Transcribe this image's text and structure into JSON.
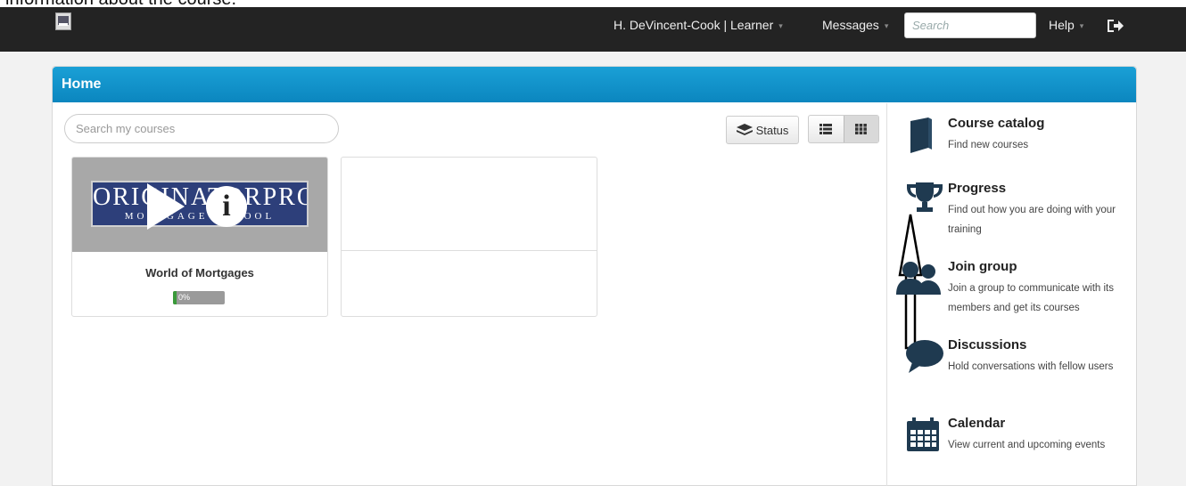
{
  "caption": "information about the course.",
  "topbar": {
    "user": "H. DeVincent-Cook | Learner",
    "messages": "Messages",
    "search_placeholder": "Search",
    "help": "Help",
    "caret": "▾"
  },
  "panel": {
    "title": "Home"
  },
  "courses": {
    "search_placeholder": "Search my courses",
    "status_label": "Status",
    "items": [
      {
        "title": "World of Mortgages",
        "progress": 0,
        "progress_label": "0%",
        "brand": "ORIGINATORPRO",
        "brand_sub": "MORTGAGE SCHOOL"
      }
    ]
  },
  "sidebar": {
    "items": [
      {
        "icon": "book-icon",
        "title": "Course catalog",
        "desc": "Find new courses"
      },
      {
        "icon": "trophy-icon",
        "title": "Progress",
        "desc": "Find out how you are doing with your training"
      },
      {
        "icon": "users-icon",
        "title": "Join group",
        "desc": "Join a group to communicate with its members and get its courses"
      },
      {
        "icon": "speech-bubble-icon",
        "title": "Discussions",
        "desc": "Hold conversations with fellow users"
      },
      {
        "icon": "calendar-icon",
        "title": "Calendar",
        "desc": "View current and upcoming events"
      }
    ]
  },
  "colors": {
    "header_blue": "#0b86bf",
    "topbar": "#232323",
    "progress_green": "#3a9a3a"
  }
}
